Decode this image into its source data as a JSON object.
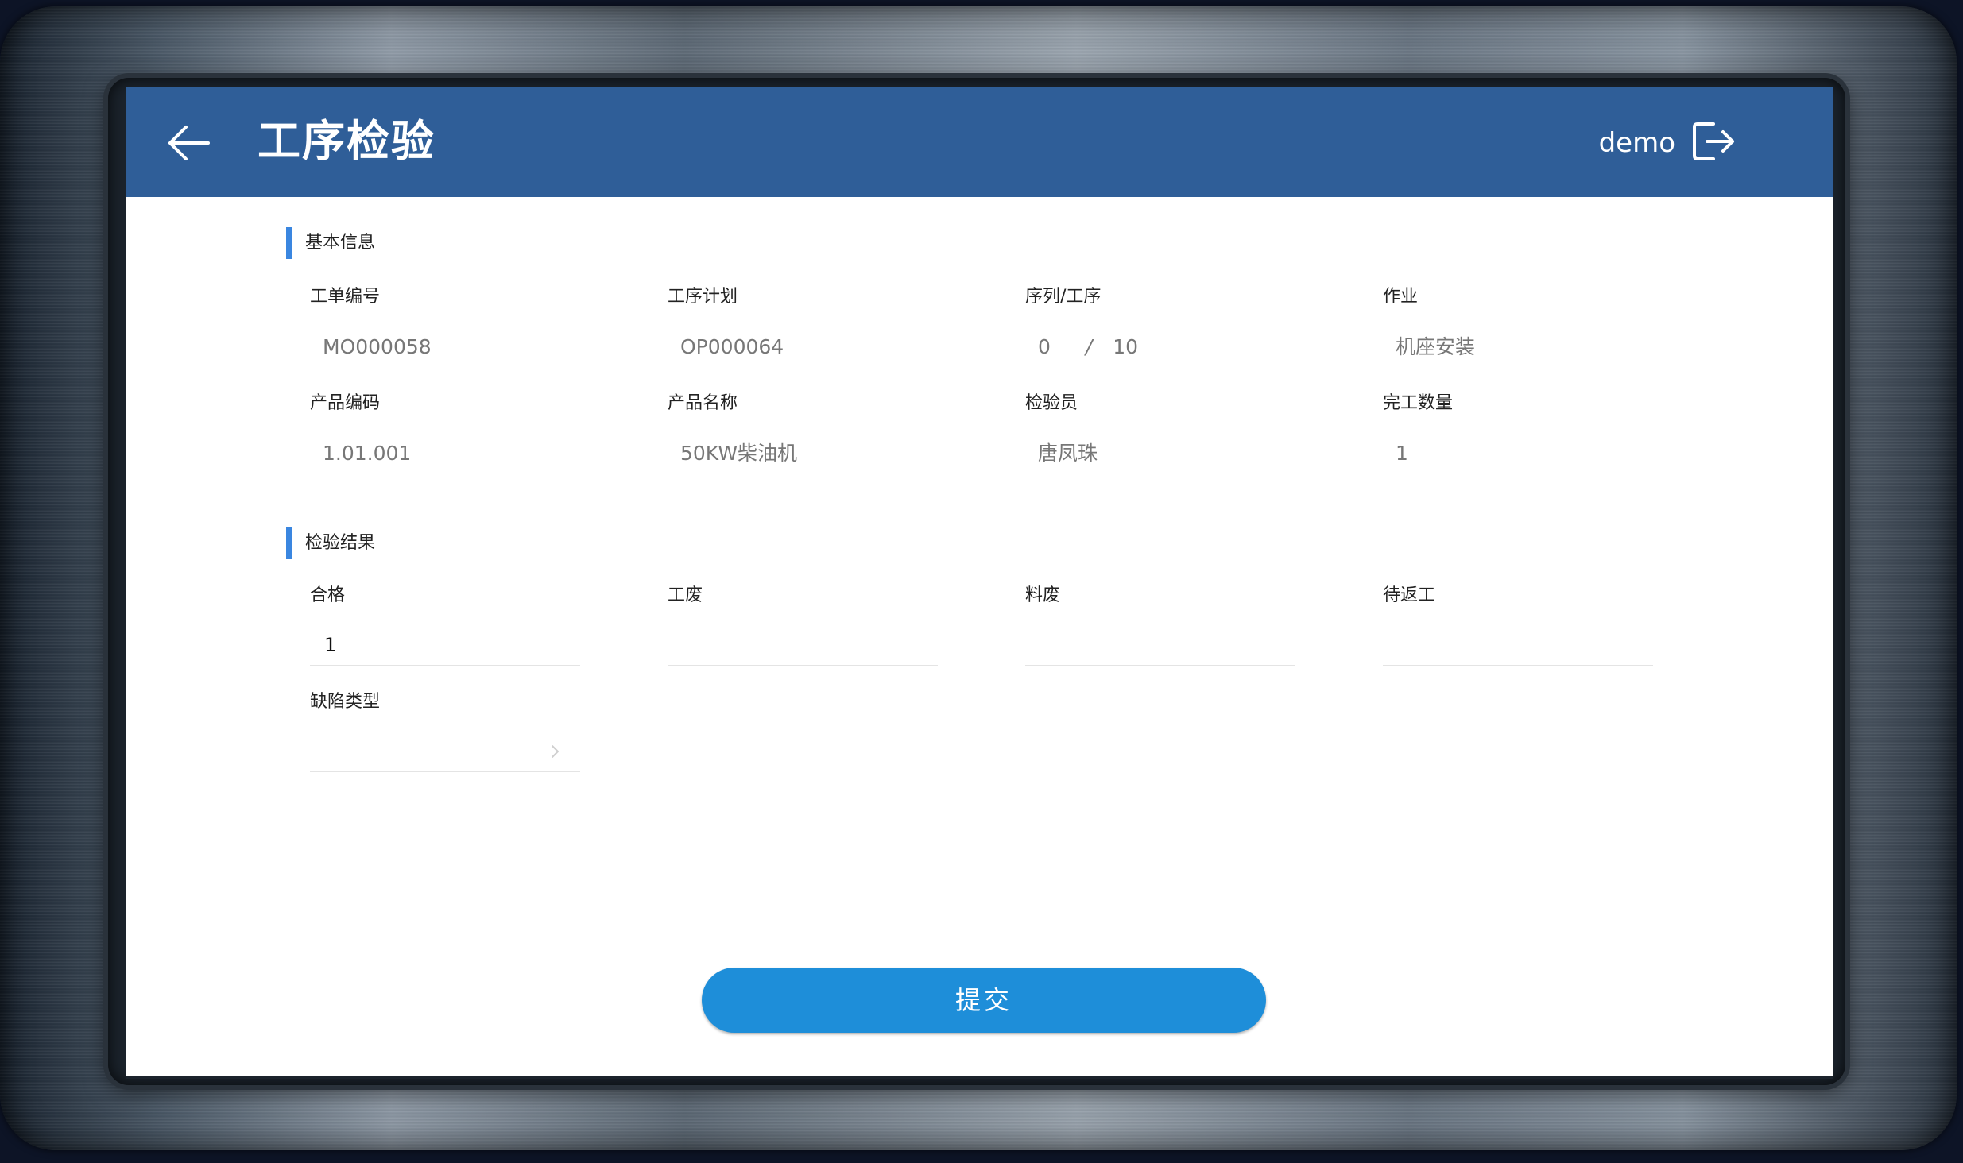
{
  "header": {
    "title": "工序检验",
    "user": "demo"
  },
  "sections": {
    "basic": "基本信息",
    "result": "检验结果"
  },
  "basic_info": {
    "work_order": {
      "label": "工单编号",
      "value": "MO000058"
    },
    "process_plan": {
      "label": "工序计划",
      "value": "OP000064"
    },
    "sequence": {
      "label": "序列/工序",
      "current": "0",
      "separator": "/",
      "total": "10"
    },
    "operation": {
      "label": "作业",
      "value": "机座安装"
    },
    "product_code": {
      "label": "产品编码",
      "value": "1.01.001"
    },
    "product_name": {
      "label": "产品名称",
      "value": "50KW柴油机"
    },
    "inspector": {
      "label": "检验员",
      "value": "唐凤珠"
    },
    "completed_qty": {
      "label": "完工数量",
      "value": "1"
    }
  },
  "inspection_result": {
    "qualified": {
      "label": "合格",
      "value": "1"
    },
    "work_scrap": {
      "label": "工废",
      "value": ""
    },
    "material_scrap": {
      "label": "料废",
      "value": ""
    },
    "pending_rework": {
      "label": "待返工",
      "value": ""
    },
    "defect_type": {
      "label": "缺陷类型",
      "value": ""
    }
  },
  "submit_label": "提交",
  "colors": {
    "header_bg": "#2f5e98",
    "accent_bar": "#3a86e0",
    "submit_bg": "#1e8ed9"
  }
}
